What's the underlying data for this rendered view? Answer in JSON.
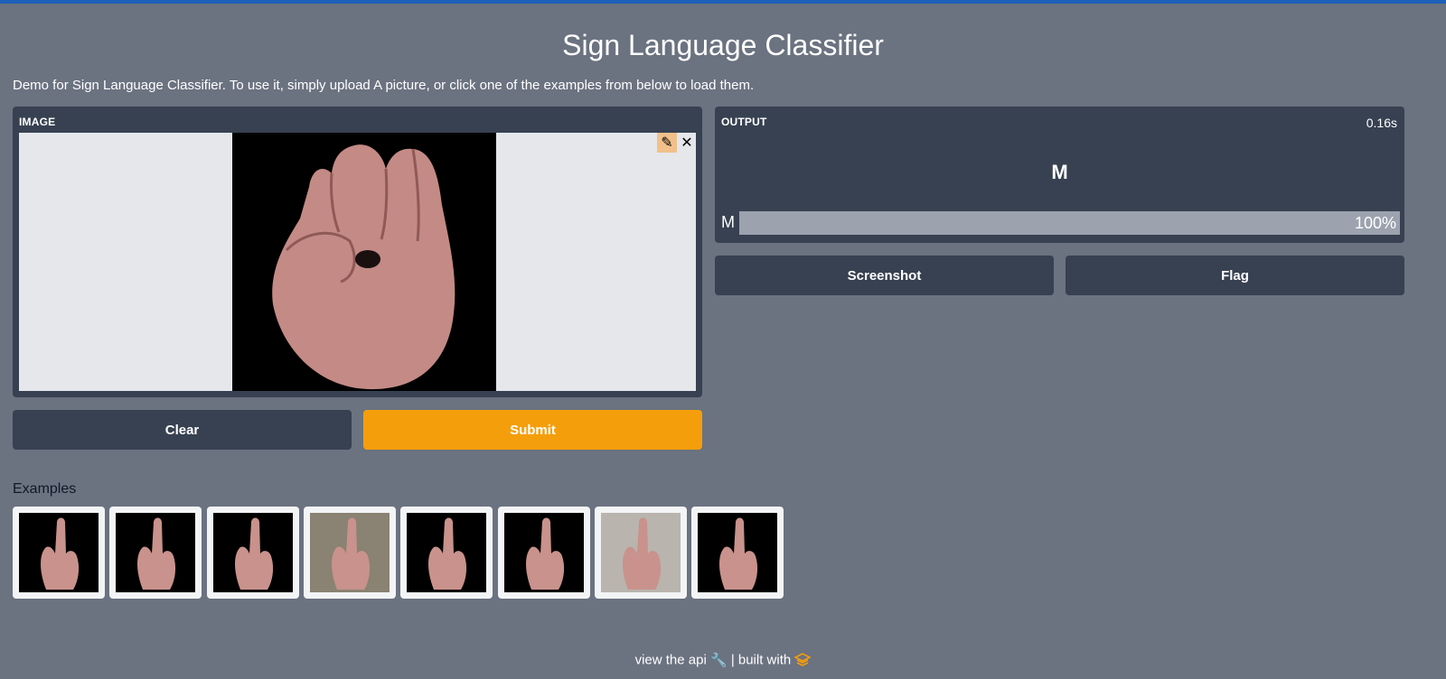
{
  "header": {
    "title": "Sign Language Classifier",
    "description": "Demo for Sign Language Classifier. To use it, simply upload A picture, or click one of the examples from below to load them."
  },
  "input_panel": {
    "label": "IMAGE",
    "edit_icon": "pencil-icon",
    "close_icon": "close-icon"
  },
  "buttons": {
    "clear": "Clear",
    "submit": "Submit",
    "screenshot": "Screenshot",
    "flag": "Flag"
  },
  "output_panel": {
    "label": "OUTPUT",
    "time": "0.16s",
    "prediction": "M",
    "bars": [
      {
        "label": "M",
        "percent_text": "100%",
        "fraction": 1.0
      }
    ]
  },
  "examples": {
    "title": "Examples",
    "items": [
      {
        "name": "example-1",
        "bg": "#000000"
      },
      {
        "name": "example-2",
        "bg": "#000000"
      },
      {
        "name": "example-3",
        "bg": "#000000"
      },
      {
        "name": "example-4",
        "bg": "#8a8272"
      },
      {
        "name": "example-5",
        "bg": "#000000"
      },
      {
        "name": "example-6",
        "bg": "#000000"
      },
      {
        "name": "example-7",
        "bg": "#b9b4ae"
      },
      {
        "name": "example-8",
        "bg": "#000000"
      }
    ]
  },
  "footer": {
    "api_text": "view the api",
    "built_text": "| built with"
  },
  "colors": {
    "background": "#6b7280",
    "panel": "#374151",
    "accent": "#f59e0b",
    "topbar": "#1d5fb8"
  }
}
